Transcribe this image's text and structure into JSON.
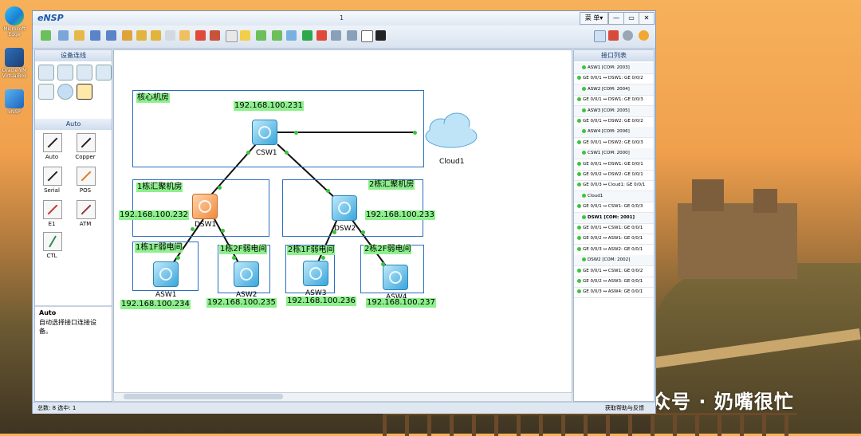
{
  "desktop": {
    "icons": [
      {
        "label": "Microsoft Edge"
      },
      {
        "label": "Oracle VM VirtualBox"
      },
      {
        "label": "eNSP"
      }
    ],
    "watermark": "公众号 · 奶嘴很忙"
  },
  "window": {
    "app_title": "eNSP",
    "tab_number": "1",
    "menu_label": "菜 单▾",
    "minimize": "—",
    "maximize": "▭",
    "close": "✕"
  },
  "left_panel": {
    "header_devices": "设备连线",
    "header_cables": "Auto",
    "cables": [
      {
        "label": "Auto",
        "color": "#222222"
      },
      {
        "label": "Copper",
        "color": "#222222"
      },
      {
        "label": "Serial",
        "color": "#222222"
      },
      {
        "label": "POS",
        "color": "#e07b1a"
      },
      {
        "label": "E1",
        "color": "#c0392b"
      },
      {
        "label": "ATM",
        "color": "#8b3a3a"
      },
      {
        "label": "CTL",
        "color": "#2e8b57"
      }
    ],
    "desc_title": "Auto",
    "desc_text": "自动选择接口连接设备。"
  },
  "canvas": {
    "areas": [
      {
        "label": "核心机房"
      },
      {
        "label": "1栋汇聚机房"
      },
      {
        "label": "2栋汇聚机房"
      },
      {
        "label": "1栋1F弱电间"
      },
      {
        "label": "1栋2F弱电间"
      },
      {
        "label": "2栋1F弱电间"
      },
      {
        "label": "2栋2F弱电间"
      }
    ],
    "devices": [
      {
        "name": "CSW1",
        "ip": "192.168.100.231"
      },
      {
        "name": "DSW1",
        "ip": "192.168.100.232"
      },
      {
        "name": "DSW2",
        "ip": "192.168.100.233"
      },
      {
        "name": "ASW1",
        "ip": "192.168.100.234"
      },
      {
        "name": "ASW2",
        "ip": "192.168.100.235"
      },
      {
        "name": "ASW3",
        "ip": "192.168.100.236"
      },
      {
        "name": "ASW4",
        "ip": "192.168.100.237"
      },
      {
        "name": "Cloud1"
      }
    ]
  },
  "right_panel": {
    "header": "接口列表",
    "rows": [
      {
        "type": "device",
        "text": "ASW1 [COM: 2003]"
      },
      {
        "type": "link",
        "text": "GE 0/0/1 ↔ DSW1: GE 0/0/2"
      },
      {
        "type": "device",
        "text": "ASW2 [COM: 2004]"
      },
      {
        "type": "link",
        "text": "GE 0/0/1 ↔ DSW1: GE 0/0/3"
      },
      {
        "type": "device",
        "text": "ASW3 [COM: 2005]"
      },
      {
        "type": "link",
        "text": "GE 0/0/1 ↔ DSW2: GE 0/0/2"
      },
      {
        "type": "device",
        "text": "ASW4 [COM: 2006]"
      },
      {
        "type": "link",
        "text": "GE 0/0/1 ↔ DSW2: GE 0/0/3"
      },
      {
        "type": "device",
        "text": "CSW1 [COM: 2000]"
      },
      {
        "type": "link",
        "text": "GE 0/0/1 ↔ DSW1: GE 0/0/1"
      },
      {
        "type": "link",
        "text": "GE 0/0/2 ↔ DSW2: GE 0/0/1"
      },
      {
        "type": "link",
        "text": "GE 0/0/3 ↔ Cloud1: GE 0/0/1"
      },
      {
        "type": "device",
        "text": "Cloud1"
      },
      {
        "type": "link",
        "text": "GE 0/0/1 ↔ CSW1: GE 0/0/3"
      },
      {
        "type": "device-bold",
        "text": "DSW1 [COM: 2001]"
      },
      {
        "type": "link",
        "text": "GE 0/0/1 ↔ CSW1: GE 0/0/1"
      },
      {
        "type": "link",
        "text": "GE 0/0/2 ↔ ASW1: GE 0/0/1"
      },
      {
        "type": "link",
        "text": "GE 0/0/3 ↔ ASW2: GE 0/0/1"
      },
      {
        "type": "device",
        "text": "DSW2 [COM: 2002]"
      },
      {
        "type": "link",
        "text": "GE 0/0/1 ↔ CSW1: GE 0/0/2"
      },
      {
        "type": "link",
        "text": "GE 0/0/2 ↔ ASW3: GE 0/0/1"
      },
      {
        "type": "link",
        "text": "GE 0/0/3 ↔ ASW4: GE 0/0/1"
      }
    ]
  },
  "statusbar": {
    "left": "总数: 8 选中: 1",
    "right": "获取帮助与反馈"
  },
  "colors": {
    "accent": "#1e5aa8",
    "label_bg": "#8df08d",
    "link_dot": "#3cc43c",
    "area_border": "#2a6dc0"
  }
}
